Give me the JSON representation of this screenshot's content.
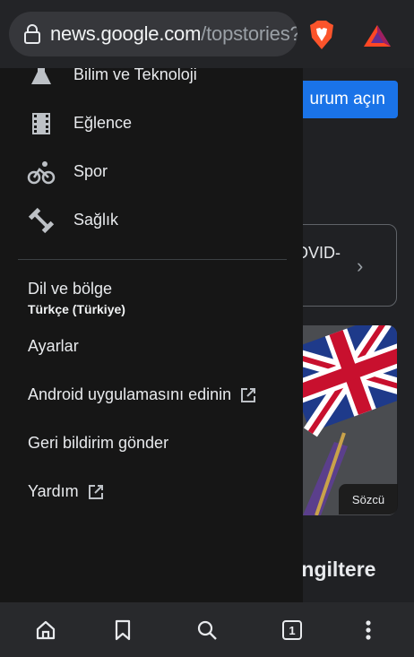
{
  "browser": {
    "url_host": "news.google.com",
    "url_path": "/topstories?"
  },
  "drawer": {
    "topics": [
      {
        "label": "Bilim ve Teknoloji",
        "icon": "flask-icon"
      },
      {
        "label": "Eğlence",
        "icon": "film-icon"
      },
      {
        "label": "Spor",
        "icon": "bicycle-icon"
      },
      {
        "label": "Sağlık",
        "icon": "dumbbell-icon"
      }
    ],
    "language_region_label": "Dil ve bölge",
    "language_region_value": "Türkçe (Türkiye)",
    "settings": "Ayarlar",
    "get_android_app": "Android uygulamasını edinin",
    "send_feedback": "Geri bildirim gönder",
    "help": "Yardım"
  },
  "background_page": {
    "cta": "urum açın",
    "card_text": "OVID-",
    "source": "Sözcü",
    "headline": "İngiltere"
  },
  "bottom_nav": {
    "tab_count": "1"
  },
  "colors": {
    "accent": "#1a73e8",
    "drawer_bg": "#161616"
  }
}
